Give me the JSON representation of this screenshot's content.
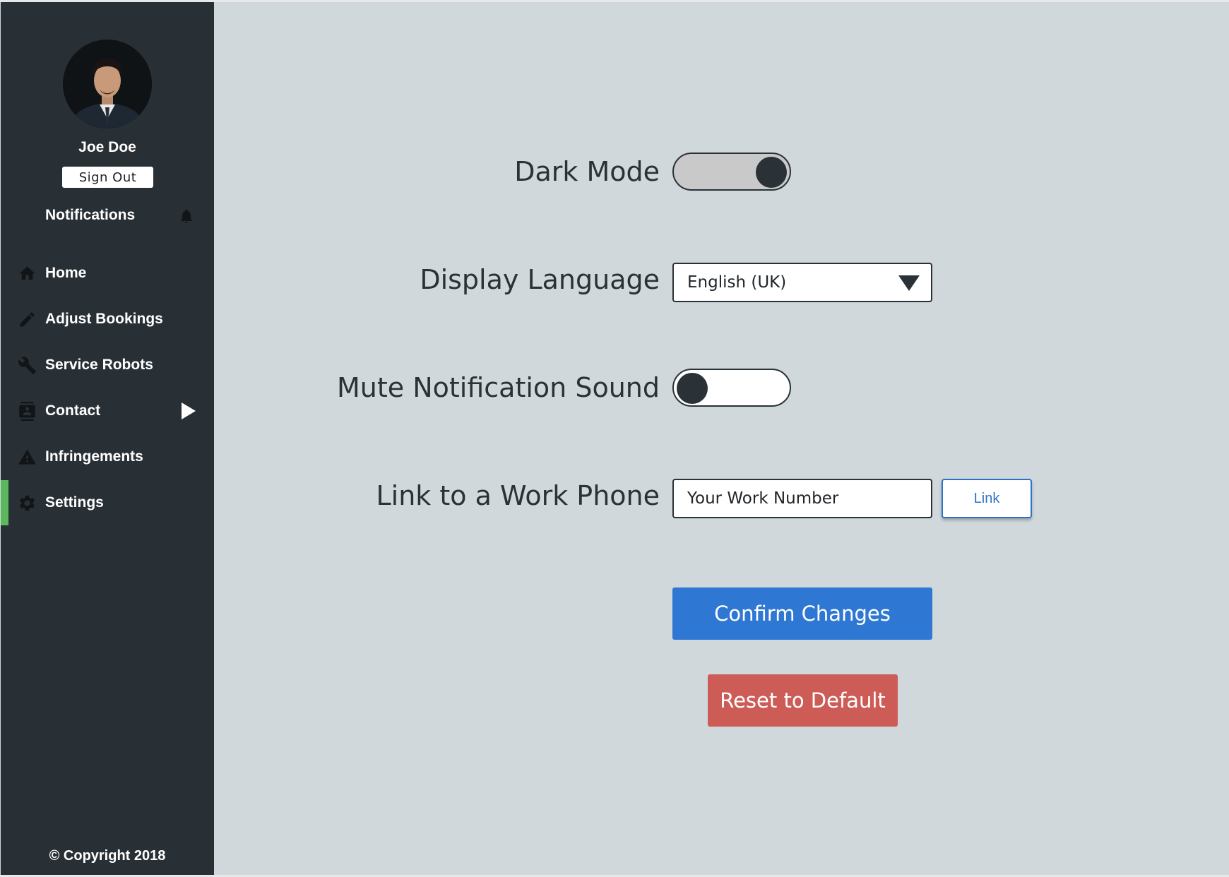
{
  "user": {
    "name": "Joe Doe",
    "sign_out_label": "Sign Out"
  },
  "sidebar": {
    "notifications_label": "Notifications",
    "items": [
      {
        "label": "Home",
        "icon": "home-icon"
      },
      {
        "label": "Adjust Bookings",
        "icon": "pencil-icon"
      },
      {
        "label": "Service Robots",
        "icon": "wrench-icon"
      },
      {
        "label": "Contact",
        "icon": "contact-icon"
      },
      {
        "label": "Infringements",
        "icon": "warning-icon"
      },
      {
        "label": "Settings",
        "icon": "gear-icon",
        "active": true
      }
    ],
    "copyright": "© Copyright 2018"
  },
  "settings": {
    "dark_mode_label": "Dark Mode",
    "dark_mode_on": true,
    "language_label": "Display Language",
    "language_value": "English (UK)",
    "mute_label": "Mute Notification Sound",
    "mute_on": false,
    "phone_label": "Link to a Work Phone",
    "phone_placeholder": "Your Work Number",
    "link_label": "Link",
    "confirm_label": "Confirm Changes",
    "reset_label": "Reset to Default"
  },
  "colors": {
    "sidebar": "#293035",
    "main_bg": "#d1d8db",
    "active_indicator": "#5cb85c",
    "confirm": "#2e77d3",
    "reset": "#cd5c57"
  }
}
